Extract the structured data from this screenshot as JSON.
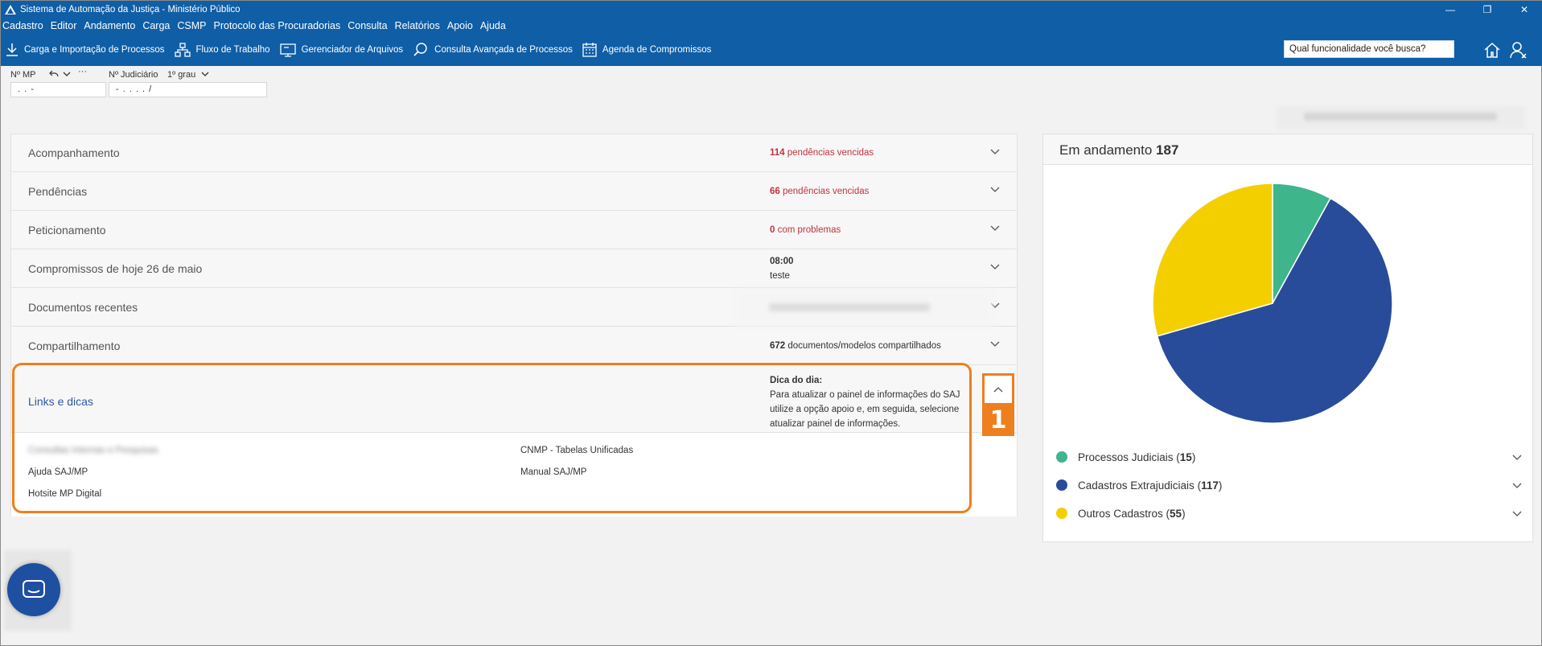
{
  "window": {
    "title": "Sistema de Automação da Justiça - Ministério Público",
    "minimize": "—",
    "restore": "❐",
    "close": "✕"
  },
  "menu": [
    "Cadastro",
    "Editor",
    "Andamento",
    "Carga",
    "CSMP",
    "Protocolo das Procuradorias",
    "Consulta",
    "Relatórios",
    "Apoio",
    "Ajuda"
  ],
  "toolbar": {
    "items": [
      "Carga e Importação de Processos",
      "Fluxo de Trabalho",
      "Gerenciador de Arquivos",
      "Consulta Avançada de Processos",
      "Agenda de Compromissos"
    ],
    "search_value": "Qual funcionalidade você busca?"
  },
  "fields": {
    "mp_label": "Nº MP",
    "mp_value": ". .    -",
    "judicial_label": "Nº Judiciário",
    "grau_label": "1º grau",
    "judicial_value": "- .  . . .  /"
  },
  "accordion": [
    {
      "title": "Acompanhamento",
      "count": "114",
      "text": " pendências vencidas"
    },
    {
      "title": "Pendências",
      "count": "66",
      "text": " pendências vencidas"
    },
    {
      "title": "Peticionamento",
      "count": "0",
      "text": " com problemas"
    },
    {
      "title": "Compromissos de hoje 26 de maio",
      "time": "08:00",
      "text": "teste"
    },
    {
      "title": "Documentos recentes"
    },
    {
      "title": "Compartilhamento",
      "count": "672",
      "text": " documentos/modelos compartilhados"
    }
  ],
  "links": {
    "title": "Links e dicas",
    "dica_label": "Dica do dia:",
    "dica_text": "Para atualizar o painel de informações do SAJ utilize a opção apoio e, em seguida, selecione atualizar painel de informações.",
    "items": [
      "Consultas Internas e Pesquisas",
      "CNMP - Tabelas Unificadas",
      "Ajuda SAJ/MP",
      "Manual SAJ/MP",
      "Hotsite MP Digital"
    ],
    "badge": "1"
  },
  "summary": {
    "label": "Em andamento",
    "total": "187",
    "legend": [
      {
        "name": "Processos Judiciais",
        "count": "15",
        "color": "#3fb58c"
      },
      {
        "name": "Cadastros Extrajudiciais",
        "count": "117",
        "color": "#284c9a"
      },
      {
        "name": "Outros Cadastros",
        "count": "55",
        "color": "#f3cf00"
      }
    ]
  },
  "chart_data": {
    "type": "pie",
    "categories": [
      "Processos Judiciais",
      "Cadastros Extrajudiciais",
      "Outros Cadastros"
    ],
    "values": [
      15,
      117,
      55
    ],
    "colors": [
      "#3fb58c",
      "#284c9a",
      "#f3cf00"
    ],
    "title": "Em andamento 187"
  }
}
